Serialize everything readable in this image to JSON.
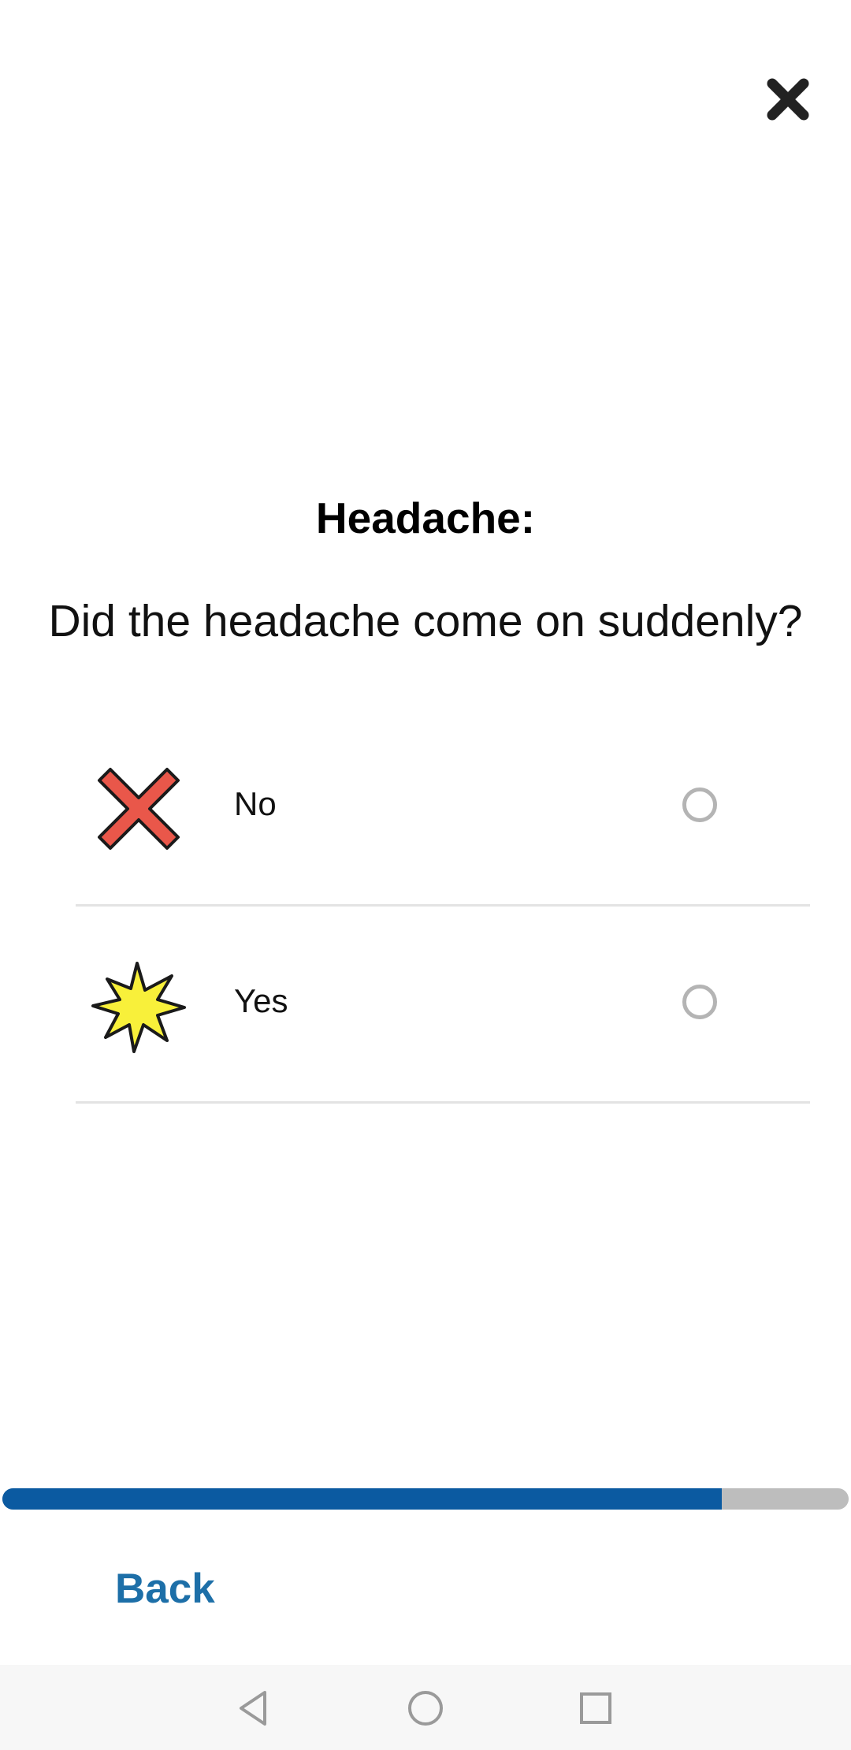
{
  "header": {
    "close_icon": "close-x-icon"
  },
  "question": {
    "title": "Headache:",
    "text": "Did the headache come on suddenly?"
  },
  "options": [
    {
      "label": "No",
      "icon": "red-cross-icon",
      "selected": false
    },
    {
      "label": "Yes",
      "icon": "yellow-starburst-icon",
      "selected": false
    }
  ],
  "progress": {
    "fraction": 0.85,
    "fill_color": "#0b5aa1",
    "track_color": "#bdbdbd"
  },
  "footer": {
    "back_label": "Back",
    "back_color": "#1d6fa8"
  },
  "system_nav": {
    "back_icon": "nav-back-triangle-icon",
    "home_icon": "nav-home-circle-icon",
    "recents_icon": "nav-recents-square-icon"
  }
}
